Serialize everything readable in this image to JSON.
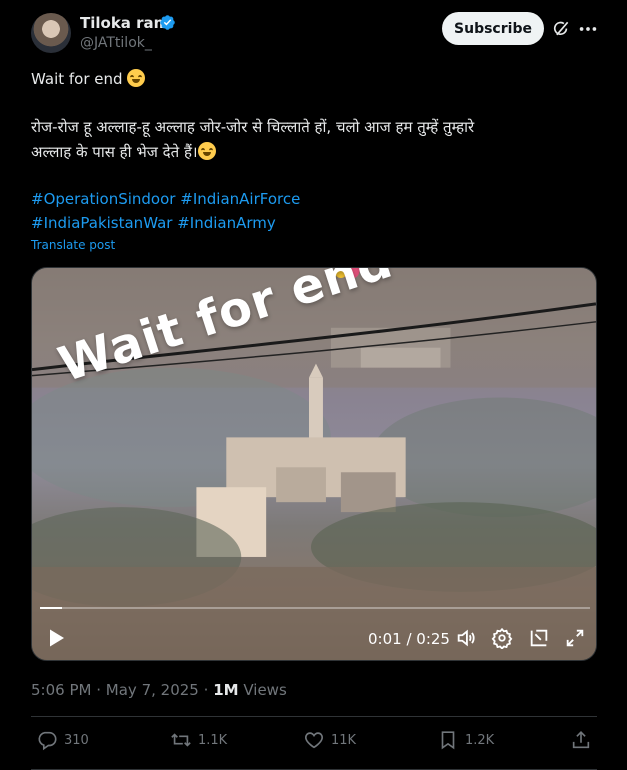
{
  "author": {
    "name": "Tiloka ram",
    "handle": "@JATtilok_"
  },
  "subscribe_label": "Subscribe",
  "post": {
    "line1_text": "Wait for end",
    "line2": "रोज-रोज हू अल्लाह-हू अल्लाह जोर-जोर से चिल्लाते हों, चलो आज हम तुम्हें तुम्हारे",
    "line3": "अल्लाह के पास ही भेज देते हैं।",
    "hashtags": [
      "#OperationSindoor",
      "#IndianAirForce",
      "#IndiaPakistanWar",
      "#IndianArmy"
    ],
    "translate": "Translate post"
  },
  "video": {
    "overlay_text": "Wait for end",
    "time": "0:01 / 0:25",
    "progress": 0.04
  },
  "meta": {
    "time": "5:06 PM",
    "date": "May 7, 2025",
    "views_count": "1M",
    "views_label": "Views"
  },
  "actions": {
    "replies": "310",
    "reposts": "1.1K",
    "likes": "11K",
    "bookmarks": "1.2K"
  },
  "colors": {
    "accent": "#1d9bf0",
    "background": "#000000",
    "muted": "#71767b"
  }
}
